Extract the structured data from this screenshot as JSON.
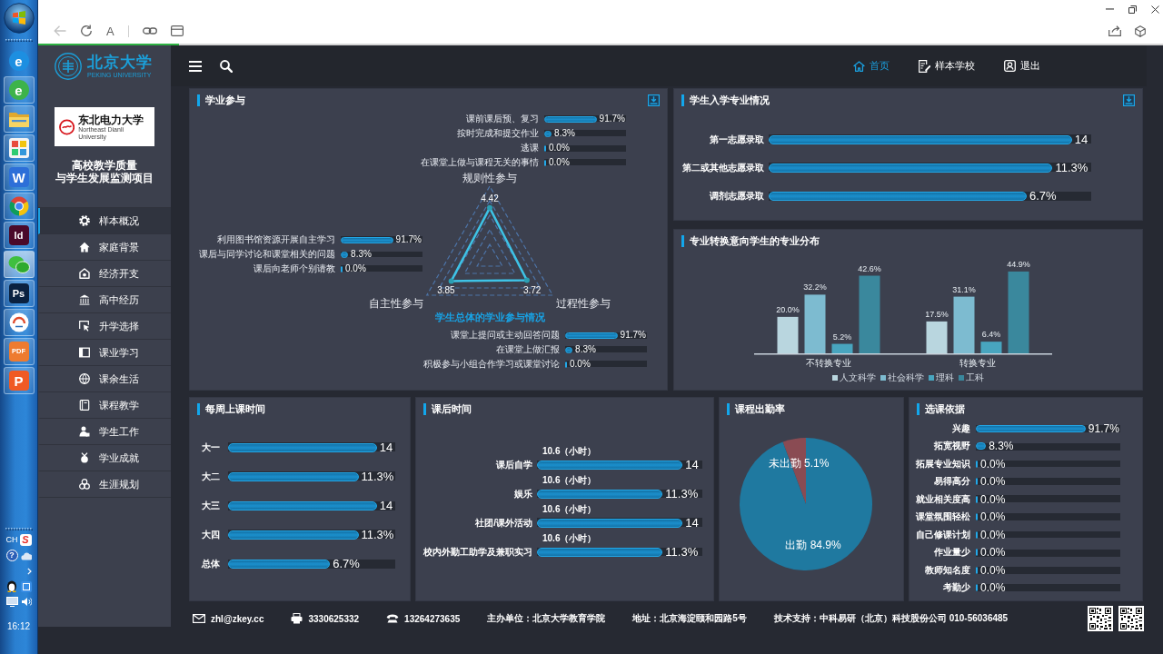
{
  "taskbar": {
    "apps": [
      {
        "kind": "round-letter",
        "glyph": "e",
        "color": "#1d8fe1",
        "running": false,
        "selected": false
      },
      {
        "kind": "round-letter",
        "glyph": "e",
        "color": "#3db34a",
        "running": true,
        "selected": false
      },
      {
        "kind": "folder",
        "running": true,
        "selected": false
      },
      {
        "kind": "tiles",
        "running": true,
        "selected": false
      },
      {
        "kind": "letter",
        "glyph": "W",
        "color": "#2d6fd8",
        "running": true,
        "selected": false
      },
      {
        "kind": "wheel",
        "running": true,
        "selected": false
      },
      {
        "kind": "letter",
        "glyph": "Id",
        "color": "#4a0a2a",
        "running": true,
        "selected": false
      },
      {
        "kind": "chat",
        "running": true,
        "selected": true
      },
      {
        "kind": "letter",
        "glyph": "Ps",
        "color": "#0b2240",
        "running": true,
        "selected": false
      },
      {
        "kind": "disc",
        "running": true,
        "selected": false
      },
      {
        "kind": "letter",
        "glyph": "PDF",
        "color": "#ee7b30",
        "running": true,
        "selected": false
      },
      {
        "kind": "letter",
        "glyph": "P",
        "color": "#f05a24",
        "running": true,
        "selected": false
      }
    ],
    "tray": {
      "language": "CH",
      "ime": "S",
      "help": "?",
      "clock": "16:12"
    }
  },
  "browser": {
    "back": {
      "disabled": true
    },
    "text_button": "A",
    "load_progress": {
      "level": 0.125
    }
  },
  "logo": {
    "name": "北京大学",
    "subtitle": "PEKING UNIVERSITY"
  },
  "partner_logo": {
    "name": "东北电力大学",
    "subtitle": "Northeast Dianli University"
  },
  "project_title": [
    "高校教学质量",
    "与学生发展监测项目"
  ],
  "sidebar": {
    "items": [
      {
        "kind": "gear",
        "label": "样本概况",
        "selected": true
      },
      {
        "kind": "home",
        "label": "家庭背景",
        "selected": false
      },
      {
        "kind": "house",
        "label": "经济开支",
        "selected": false
      },
      {
        "kind": "columns",
        "label": "高中经历",
        "selected": false
      },
      {
        "kind": "pointer",
        "label": "升学选择",
        "selected": false
      },
      {
        "kind": "book",
        "label": "课业学习",
        "selected": false
      },
      {
        "kind": "ball",
        "label": "课余生活",
        "selected": false
      },
      {
        "kind": "notebook",
        "label": "课程教学",
        "selected": false
      },
      {
        "kind": "person",
        "label": "学生工作",
        "selected": false
      },
      {
        "kind": "medal",
        "label": "学业成就",
        "selected": false
      },
      {
        "kind": "circles",
        "label": "生涯规划",
        "selected": false
      }
    ]
  },
  "header": {
    "nav": [
      {
        "kind": "home",
        "label": "首页",
        "selected": true
      },
      {
        "kind": "document",
        "label": "样本学校",
        "selected": false
      },
      {
        "kind": "user",
        "label": "退出",
        "selected": false
      }
    ]
  },
  "academic_engagement": {
    "title": "学业参与",
    "download": true,
    "groups": [
      {
        "items": [
          {
            "label": "课前课后预、复习",
            "value": "91.7%",
            "level": 0.64
          },
          {
            "label": "按时完成和提交作业",
            "value": "8.3%",
            "level": 0.09
          },
          {
            "label": "逃课",
            "value": "0.0%",
            "level": 0
          },
          {
            "label": "在课堂上做与课程无关的事情",
            "value": "0.0%",
            "level": 0
          }
        ]
      },
      {
        "items": [
          {
            "label": "利用图书馆资源开展自主学习",
            "value": "91.7%",
            "level": 0.64
          },
          {
            "label": "课后与同学讨论和课堂相关的问题",
            "value": "8.3%",
            "level": 0.09
          },
          {
            "label": "课后向老师个别请教",
            "value": "0.0%",
            "level": 0
          }
        ]
      },
      {
        "items": [
          {
            "label": "课堂上提问或主动回答问题",
            "value": "91.7%",
            "level": 0.64
          },
          {
            "label": "在课堂上做汇报",
            "value": "8.3%",
            "level": 0.09
          },
          {
            "label": "积极参与小组合作学习或课堂讨论",
            "value": "0.0%",
            "level": 0
          }
        ]
      }
    ],
    "radar": {
      "title": "学生总体的学业参与情况",
      "axes": [
        {
          "label": "规则性参与",
          "value": "4.42"
        },
        {
          "label": "自主性参与",
          "value": "3.85"
        },
        {
          "label": "过程性参与",
          "value": "3.72"
        }
      ]
    }
  },
  "enrollment": {
    "title": "学生入学专业情况",
    "download": true,
    "rows": [
      {
        "label": "第一志愿录取",
        "value": "14",
        "level": 0.94
      },
      {
        "label": "第二或其他志愿录取",
        "value": "11.3%",
        "level": 0.88
      },
      {
        "label": "调剂志愿录取",
        "value": "6.7%",
        "level": 0.8
      }
    ]
  },
  "major_change": {
    "title": "专业转换意向学生的专业分布",
    "chart_data": {
      "type": "bar",
      "categories": [
        "不转换专业",
        "转换专业"
      ],
      "series": [
        {
          "name": "人文科学",
          "color": "#b9d6df",
          "values": [
            20.0,
            17.5
          ],
          "value_labels": [
            "20.0%",
            "17.5%"
          ]
        },
        {
          "name": "社会科学",
          "color": "#7dbbd0",
          "values": [
            32.2,
            31.1
          ],
          "value_labels": [
            "32.2%",
            "31.1%"
          ]
        },
        {
          "name": "理科",
          "color": "#48a5bf",
          "values": [
            5.2,
            6.4
          ],
          "value_labels": [
            "5.2%",
            "6.4%"
          ]
        },
        {
          "name": "工科",
          "color": "#3a889d",
          "values": [
            42.6,
            44.9
          ],
          "value_labels": [
            "42.6%",
            "44.9%"
          ]
        }
      ],
      "legend": "bottom"
    }
  },
  "weekly_hours": {
    "title": "每周上课时间",
    "rows": [
      {
        "label": "大一",
        "value": "14",
        "level": 0.89
      },
      {
        "label": "大二",
        "value": "11.3%",
        "level": 0.78
      },
      {
        "label": "大三",
        "value": "14",
        "level": 0.89
      },
      {
        "label": "大四",
        "value": "11.3%",
        "level": 0.78
      },
      {
        "label": "总体",
        "value": "6.7%",
        "level": 0.61
      }
    ]
  },
  "after_class": {
    "title": "课后时间",
    "rows": [
      {
        "label": "课后自学",
        "note": "10.6（小时）",
        "value": "14",
        "level": 0.88
      },
      {
        "label": "娱乐",
        "note": "10.6（小时）",
        "value": "11.3%",
        "level": 0.76
      },
      {
        "label": "社团/课外活动",
        "note": "10.6（小时）",
        "value": "14",
        "level": 0.88
      },
      {
        "label": "校内外勤工助学及兼职实习",
        "note": "10.6（小时）",
        "value": "11.3%",
        "level": 0.76
      }
    ]
  },
  "attendance": {
    "title": "课程出勤率",
    "chart_data": {
      "type": "pie",
      "categories": [
        "未出勤",
        "出勤"
      ],
      "values": [
        5.1,
        84.9
      ],
      "colors": [
        "#8a4b53",
        "#1f79a0"
      ],
      "value_labels": [
        "5.1%",
        "84.9%"
      ]
    }
  },
  "course_selection": {
    "title": "选课依据",
    "rows": [
      {
        "label": "兴趣",
        "value": "91.7%",
        "level": 0.76
      },
      {
        "label": "拓宽视野",
        "value": "8.3%",
        "level": 0.07
      },
      {
        "label": "拓展专业知识",
        "value": "0.0%",
        "level": 0
      },
      {
        "label": "易得高分",
        "value": "0.0%",
        "level": 0
      },
      {
        "label": "就业相关度高",
        "value": "0.0%",
        "level": 0
      },
      {
        "label": "课堂氛围轻松",
        "value": "0.0%",
        "level": 0
      },
      {
        "label": "自己修课计划",
        "value": "0.0%",
        "level": 0
      },
      {
        "label": "作业量少",
        "value": "0.0%",
        "level": 0
      },
      {
        "label": "教师知名度",
        "value": "0.0%",
        "level": 0
      },
      {
        "label": "考勤少",
        "value": "0.0%",
        "level": 0
      }
    ]
  },
  "footer": {
    "items": [
      {
        "kind": "mail",
        "text": "zhl@zkey.cc"
      },
      {
        "kind": "fax",
        "text": "3330625332"
      },
      {
        "kind": "phone",
        "text": "13264273635"
      },
      {
        "kind": "text",
        "text": "主办单位：北京大学教育学院"
      },
      {
        "kind": "text",
        "text": "地址：北京海淀颐和园路5号"
      },
      {
        "kind": "text",
        "text": "技术支持：中科易研（北京）科技股份公司 010-56036485"
      }
    ]
  }
}
